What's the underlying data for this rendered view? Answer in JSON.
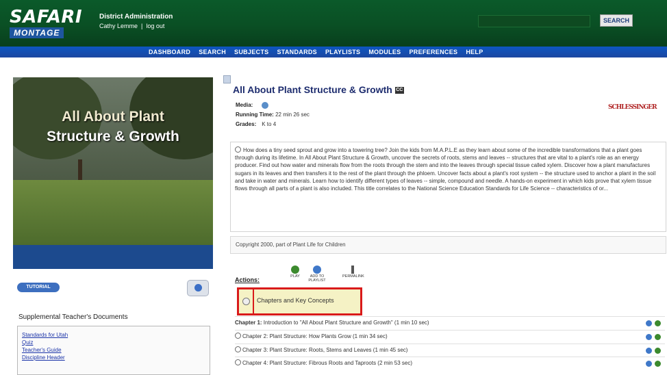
{
  "header": {
    "logo_top": "SAFARI",
    "logo_bottom": "MONTAGE",
    "district": "District Administration",
    "user_name": "Cathy Lemme",
    "logout": "log out",
    "search_button": "SEARCH"
  },
  "nav": {
    "items": [
      "DASHBOARD",
      "SEARCH",
      "SUBJECTS",
      "STANDARDS",
      "PLAYLISTS",
      "MODULES",
      "PREFERENCES",
      "HELP"
    ]
  },
  "video": {
    "title_line1": "All About Plant",
    "title_line2": "Structure & Growth"
  },
  "left": {
    "tutorial_button": "TUTORIAL",
    "supp_title": "Supplemental Teacher's Documents",
    "supp_links": [
      "Standards for Utah",
      "Quiz",
      "Teacher's Guide",
      "Discipline Header"
    ]
  },
  "program": {
    "title": "All About Plant Structure & Growth",
    "cc_label": "CC",
    "media_label": "Media:",
    "running_time_label": "Running Time:",
    "running_time": "22 min 26 sec",
    "grades_label": "Grades:",
    "grades": "K to 4",
    "publisher": "SCHLESSINGER",
    "description": "How does a tiny seed sprout and grow into a towering tree? Join the kids from M.A.P.L.E as they learn about some of the incredible transformations that a plant goes through during its lifetime. In All About Plant Structure & Growth, uncover the secrets of roots, stems and leaves -- structures that are vital to a plant's role as an energy producer. Find out how water and minerals flow from the roots through the stem and into the leaves through special tissue called xylem. Discover how a plant manufactures sugars in its leaves and then transfers it to the rest of the plant through the phloem. Uncover facts about a plant's root system -- the structure used to anchor a plant in the soil and take in water and minerals. Learn how to identify different types of leaves -- simple, compound and needle. A hands-on experiment in which kids prove that xylem tissue flows through all parts of a plant is also included. This title correlates to the National Science Education Standards for Life Science -- characteristics of or...",
    "copyright": "Copyright 2000, part of Plant Life for Children"
  },
  "actions": {
    "label": "Actions:",
    "play": "PLAY",
    "add_to_playlist": "ADD TO PLAYLIST",
    "permalink": "PERMALINK"
  },
  "chapters": {
    "toggle_label": "Chapters and Key Concepts",
    "rows": [
      {
        "num": "Chapter 1:",
        "title": "Introduction to \"All About Plant Structure and Growth\" (1 min 10 sec)"
      },
      {
        "num": "Chapter 2:",
        "title": "Plant Structure: How Plants Grow (1 min 34 sec)"
      },
      {
        "num": "Chapter 3:",
        "title": "Plant Structure: Roots, Stems and Leaves (1 min 45 sec)"
      },
      {
        "num": "Chapter 4:",
        "title": "Plant Structure: Fibrous Roots and Taproots (2 min 53 sec)"
      }
    ]
  },
  "colors": {
    "header_green": "#0a4f24",
    "nav_blue": "#1b47a0",
    "title_navy": "#1d2c6e",
    "highlight_red": "#d91a1a",
    "highlight_fill": "#f5f2c5",
    "link_blue": "#1a33a8"
  }
}
